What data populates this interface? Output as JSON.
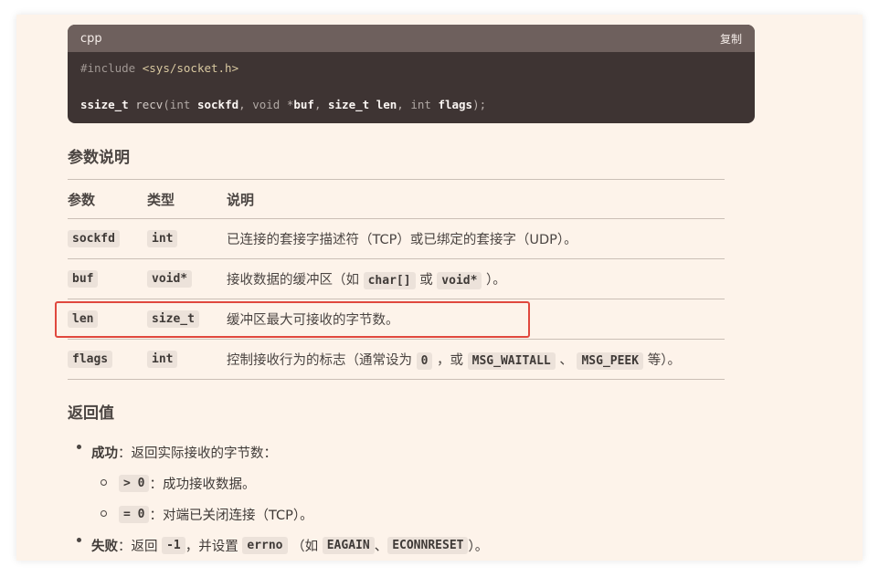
{
  "code_block": {
    "language": "cpp",
    "copy_label": "复制",
    "line1": {
      "directive": "#include",
      "header": "<sys/socket.h>"
    },
    "line2": {
      "ret_type": "ssize_t",
      "fn": "recv",
      "p1_type": "int",
      "p1_name": "sockfd",
      "p2_type": "void",
      "p2_name": "buf",
      "p3_type": "size_t",
      "p3_name": "len",
      "p4_type": "int",
      "p4_name": "flags"
    }
  },
  "params_section": {
    "title": "参数说明",
    "headers": [
      "参数",
      "类型",
      "说明"
    ],
    "rows": [
      {
        "param": "sockfd",
        "type": "int",
        "desc": "已连接的套接字描述符（TCP）或已绑定的套接字（UDP）。"
      },
      {
        "param": "buf",
        "type": "void*",
        "desc_pre": "接收数据的缓冲区（如",
        "code1": "char[]",
        "desc_mid": "或",
        "code2": "void*",
        "desc_post": "）。"
      },
      {
        "param": "len",
        "type": "size_t",
        "desc": "缓冲区最大可接收的字节数。"
      },
      {
        "param": "flags",
        "type": "int",
        "desc_pre": "控制接收行为的标志（通常设为",
        "code1": "0",
        "desc_mid1": "，或",
        "code2": "MSG_WAITALL",
        "desc_mid2": "、",
        "code3": "MSG_PEEK",
        "desc_post": "等）。"
      }
    ]
  },
  "return_section": {
    "title": "返回值",
    "success": {
      "label": "成功",
      "text": "：返回实际接收的字节数：",
      "sub": [
        {
          "code": "> 0",
          "text": "：成功接收数据。"
        },
        {
          "code": "= 0",
          "text": "：对端已关闭连接（TCP）。"
        }
      ]
    },
    "failure": {
      "label": "失败",
      "text1": "：返回",
      "code1": "-1",
      "text2": "，并设置",
      "code2": "errno",
      "text3": "（如",
      "code3": "EAGAIN",
      "text4": "、",
      "code4": "ECONNRESET",
      "text5": "）。"
    }
  },
  "colors": {
    "highlight_box": "#e0483e",
    "code_bg": "#3e3433",
    "page_bg": "#fdf3ea"
  }
}
